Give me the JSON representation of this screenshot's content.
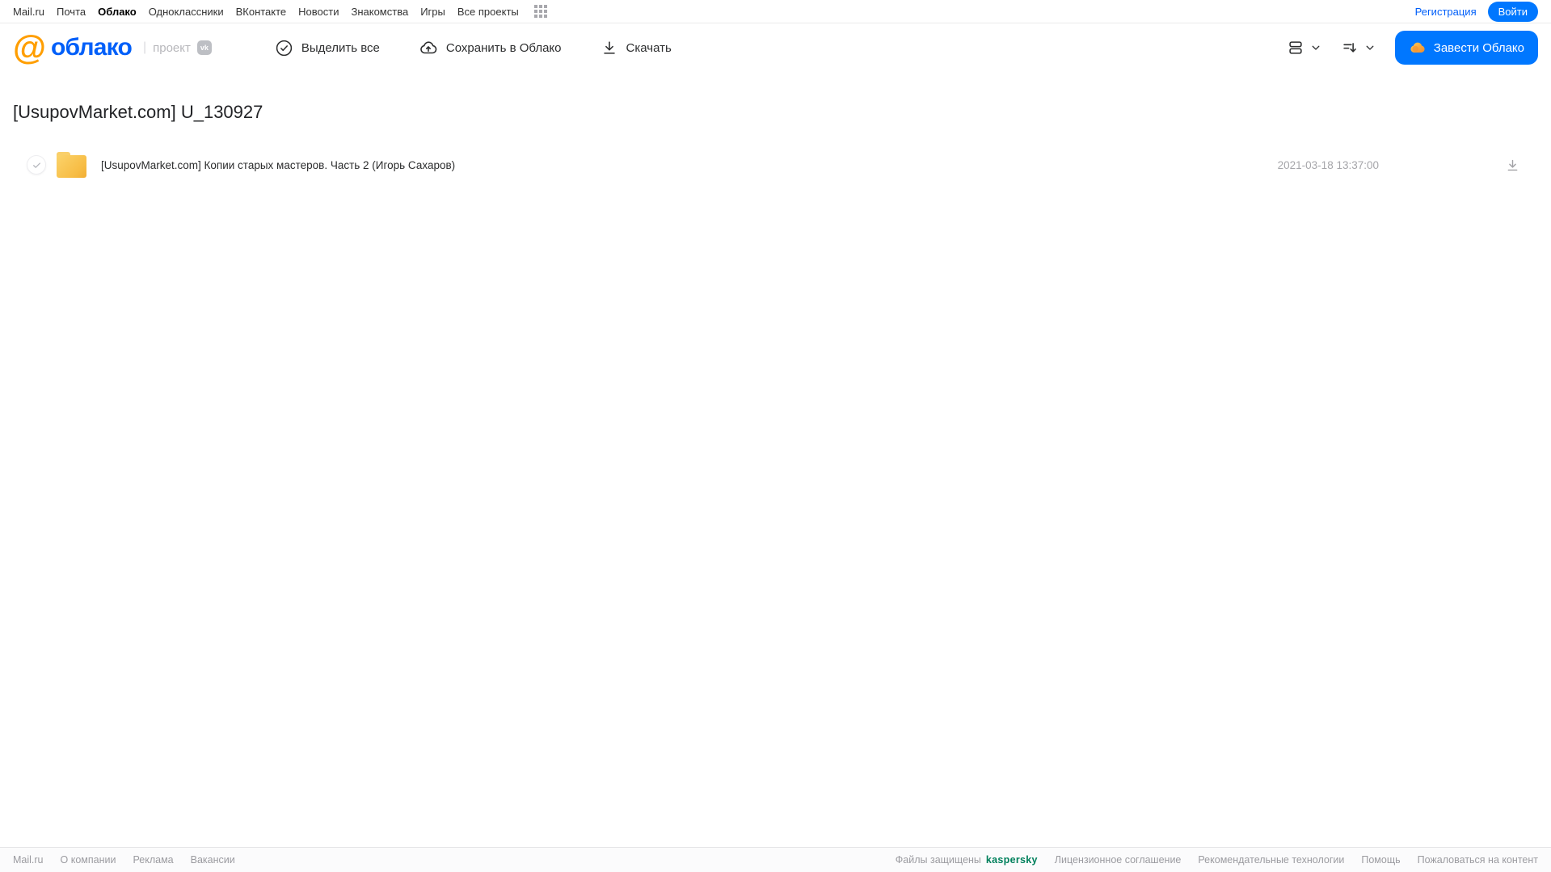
{
  "topbar": {
    "links": [
      "Mail.ru",
      "Почта",
      "Облако",
      "Одноклассники",
      "ВКонтакте",
      "Новости",
      "Знакомства",
      "Игры",
      "Все проекты"
    ],
    "active_link": "Облако",
    "registration_label": "Регистрация",
    "login_label": "Войти"
  },
  "header": {
    "logo_at": "@",
    "logo_text": "облако",
    "divider": "|",
    "project_label": "проект",
    "vk_badge": "vk",
    "toolbar": {
      "select_all_label": "Выделить все",
      "save_to_cloud_label": "Сохранить в Облако",
      "download_label": "Скачать"
    },
    "get_cloud_label": "Завести Облако"
  },
  "main": {
    "title": "[UsupovMarket.com] U_130927",
    "files": [
      {
        "type": "folder",
        "name": "[UsupovMarket.com] Копии старых мастеров. Часть 2 (Игорь Сахаров)",
        "date": "2021-03-18 13:37:00"
      }
    ]
  },
  "footer": {
    "left_links": [
      "Mail.ru",
      "О компании",
      "Реклама",
      "Вакансии"
    ],
    "files_protected_label": "Файлы защищены",
    "kaspersky_label": "kaspersky",
    "right_links": [
      "Лицензионное соглашение",
      "Рекомендательные технологии",
      "Помощь",
      "Пожаловаться на контент"
    ]
  },
  "colors": {
    "accent_blue": "#0077ff",
    "logo_blue": "#005ff9",
    "logo_orange": "#ff9e00",
    "folder_yellow": "#f7bd45",
    "kaspersky_green": "#00805c"
  }
}
